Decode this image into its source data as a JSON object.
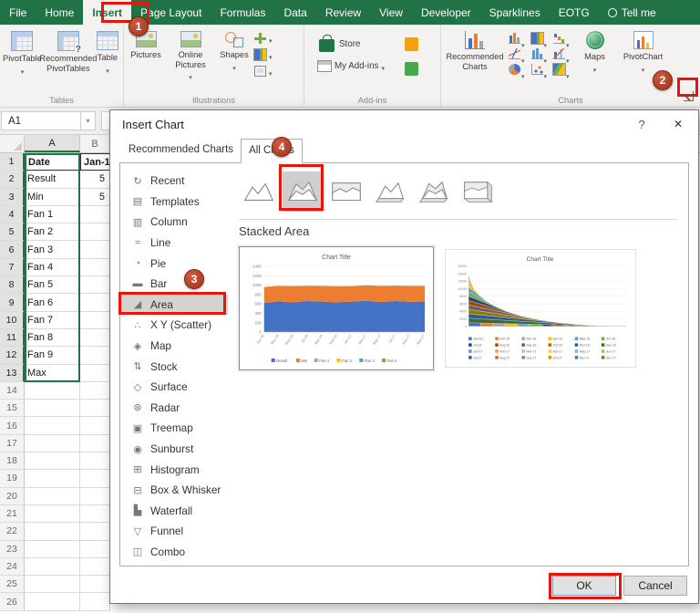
{
  "colors": {
    "excel_green": "#217346",
    "annotation_red": "#e8150a",
    "badge_red": "#a03418",
    "series_blue": "#4472c4",
    "series_orange": "#ed7d31"
  },
  "ribbon_tabs": [
    {
      "label": "File"
    },
    {
      "label": "Home"
    },
    {
      "label": "Insert",
      "active": true
    },
    {
      "label": "Page Layout"
    },
    {
      "label": "Formulas"
    },
    {
      "label": "Data"
    },
    {
      "label": "Review"
    },
    {
      "label": "View"
    },
    {
      "label": "Developer"
    },
    {
      "label": "Sparklines"
    },
    {
      "label": "EOTG"
    },
    {
      "label": "Tell me"
    }
  ],
  "ribbon": {
    "tables": {
      "group": "Tables",
      "b1": "PivotTable",
      "b2": "Recommended PivotTables",
      "b3": "Table"
    },
    "illustrations": {
      "group": "Illustrations",
      "b1": "Pictures",
      "b2": "Online Pictures",
      "b3": "Shapes"
    },
    "addins": {
      "group": "Add-ins",
      "b1": "Store",
      "b2": "My Add-ins"
    },
    "charts": {
      "group": "Charts",
      "b1": "Recommended Charts",
      "b2": "Maps",
      "b3": "PivotChart"
    }
  },
  "formula_bar": {
    "name_box": "A1"
  },
  "sheet": {
    "columns": [
      "A",
      "B"
    ],
    "rows": [
      {
        "n": "1",
        "a": "Date",
        "b": "Jan-1"
      },
      {
        "n": "2",
        "a": "Result",
        "b": "5"
      },
      {
        "n": "3",
        "a": "Min",
        "b": "5"
      },
      {
        "n": "4",
        "a": "Fan 1",
        "b": ""
      },
      {
        "n": "5",
        "a": "Fan 2",
        "b": ""
      },
      {
        "n": "6",
        "a": "Fan 3",
        "b": ""
      },
      {
        "n": "7",
        "a": "Fan 4",
        "b": ""
      },
      {
        "n": "8",
        "a": "Fan 5",
        "b": ""
      },
      {
        "n": "9",
        "a": "Fan 6",
        "b": ""
      },
      {
        "n": "10",
        "a": "Fan 7",
        "b": ""
      },
      {
        "n": "11",
        "a": "Fan 8",
        "b": ""
      },
      {
        "n": "12",
        "a": "Fan 9",
        "b": ""
      },
      {
        "n": "13",
        "a": "Max",
        "b": ""
      },
      {
        "n": "14",
        "a": "",
        "b": ""
      },
      {
        "n": "15",
        "a": "",
        "b": ""
      },
      {
        "n": "16",
        "a": "",
        "b": ""
      },
      {
        "n": "17",
        "a": "",
        "b": ""
      },
      {
        "n": "18",
        "a": "",
        "b": ""
      },
      {
        "n": "19",
        "a": "",
        "b": ""
      },
      {
        "n": "20",
        "a": "",
        "b": ""
      },
      {
        "n": "21",
        "a": "",
        "b": ""
      },
      {
        "n": "22",
        "a": "",
        "b": ""
      },
      {
        "n": "23",
        "a": "",
        "b": ""
      },
      {
        "n": "24",
        "a": "",
        "b": ""
      },
      {
        "n": "25",
        "a": "",
        "b": ""
      },
      {
        "n": "26",
        "a": "",
        "b": ""
      }
    ]
  },
  "dialog": {
    "title": "Insert Chart",
    "help": "?",
    "close": "✕",
    "tabs": [
      {
        "label": "Recommended Charts"
      },
      {
        "label": "All Charts",
        "active": true
      }
    ],
    "sidebar": [
      {
        "label": "Recent",
        "glyph": "↻"
      },
      {
        "label": "Templates",
        "glyph": "▤"
      },
      {
        "label": "Column",
        "glyph": "▥"
      },
      {
        "label": "Line",
        "glyph": "≈"
      },
      {
        "label": "Pie",
        "glyph": "◔"
      },
      {
        "label": "Bar",
        "glyph": "▬"
      },
      {
        "label": "Area",
        "glyph": "◢",
        "selected": true
      },
      {
        "label": "X Y (Scatter)",
        "glyph": "∴"
      },
      {
        "label": "Map",
        "glyph": "◈"
      },
      {
        "label": "Stock",
        "glyph": "⇅"
      },
      {
        "label": "Surface",
        "glyph": "◇"
      },
      {
        "label": "Radar",
        "glyph": "⊛"
      },
      {
        "label": "Treemap",
        "glyph": "▣"
      },
      {
        "label": "Sunburst",
        "glyph": "◉"
      },
      {
        "label": "Histogram",
        "glyph": "⊞"
      },
      {
        "label": "Box & Whisker",
        "glyph": "⊟"
      },
      {
        "label": "Waterfall",
        "glyph": "▙"
      },
      {
        "label": "Funnel",
        "glyph": "▽"
      },
      {
        "label": "Combo",
        "glyph": "◫"
      }
    ],
    "subtype_heading": "Stacked Area",
    "ok": "OK",
    "cancel": "Cancel"
  },
  "badges": {
    "b1": "1",
    "b2": "2",
    "b3": "3",
    "b4": "4"
  },
  "chart_data": [
    {
      "type": "area",
      "variant": "stacked",
      "title": "Chart Title",
      "ylim": [
        0,
        1400
      ],
      "ystep": 200,
      "x": [
        "Jan-16",
        "Mar-16",
        "May-16",
        "Jul-16",
        "Sep-16",
        "Nov-16",
        "Jan-17",
        "Mar-17",
        "May-17",
        "Jul-17",
        "Sep-17",
        "Nov-17"
      ],
      "series": [
        {
          "name": "Result",
          "color": "#4472c4",
          "values": [
            620,
            655,
            635,
            660,
            650,
            635,
            650,
            665,
            640,
            660,
            645,
            652
          ]
        },
        {
          "name": "Min",
          "color": "#ed7d31",
          "values": [
            340,
            330,
            345,
            328,
            335,
            342,
            330,
            332,
            345,
            330,
            340,
            333
          ]
        }
      ],
      "legend": [
        {
          "label": "Result",
          "color": "#4472c4"
        },
        {
          "label": "Min",
          "color": "#ed7d31"
        },
        {
          "label": "Fan 1",
          "color": "#a5a5a5"
        },
        {
          "label": "Fan 2",
          "color": "#ffc000"
        },
        {
          "label": "Fan 3",
          "color": "#5b9bd5"
        },
        {
          "label": "Fan 4",
          "color": "#70ad47"
        }
      ]
    },
    {
      "type": "area",
      "variant": "3d-stacked",
      "title": "Chart Title",
      "ylim": [
        0,
        16000
      ],
      "ystep": 2000,
      "legend": [
        {
          "label": "Jan-16",
          "color": "#4472c4"
        },
        {
          "label": "Feb-16",
          "color": "#ed7d31"
        },
        {
          "label": "Mar-16",
          "color": "#a5a5a5"
        },
        {
          "label": "Apr-16",
          "color": "#ffc000"
        },
        {
          "label": "May-16",
          "color": "#5b9bd5"
        },
        {
          "label": "Jun-16",
          "color": "#70ad47"
        },
        {
          "label": "Jul-16",
          "color": "#264478"
        },
        {
          "label": "Aug-16",
          "color": "#9e480e"
        },
        {
          "label": "Sep-16",
          "color": "#636363"
        },
        {
          "label": "Oct-16",
          "color": "#997300"
        },
        {
          "label": "Nov-16",
          "color": "#255e91"
        },
        {
          "label": "Dec-16",
          "color": "#43682b"
        },
        {
          "label": "Jan-17",
          "color": "#698ed0"
        },
        {
          "label": "Feb-17",
          "color": "#f1975a"
        },
        {
          "label": "Mar-17",
          "color": "#b7b7b7"
        },
        {
          "label": "Apr-17",
          "color": "#ffcd33"
        },
        {
          "label": "May-17",
          "color": "#7cafdd"
        },
        {
          "label": "Jun-17",
          "color": "#8cc168"
        },
        {
          "label": "Jul-17",
          "color": "#335aa1"
        },
        {
          "label": "Aug-17",
          "color": "#cb6a17"
        },
        {
          "label": "Sep-17",
          "color": "#848484"
        },
        {
          "label": "Oct-17",
          "color": "#c99a00"
        },
        {
          "label": "Nov-17",
          "color": "#327dc2"
        },
        {
          "label": "Dec-17",
          "color": "#588739"
        }
      ]
    }
  ]
}
